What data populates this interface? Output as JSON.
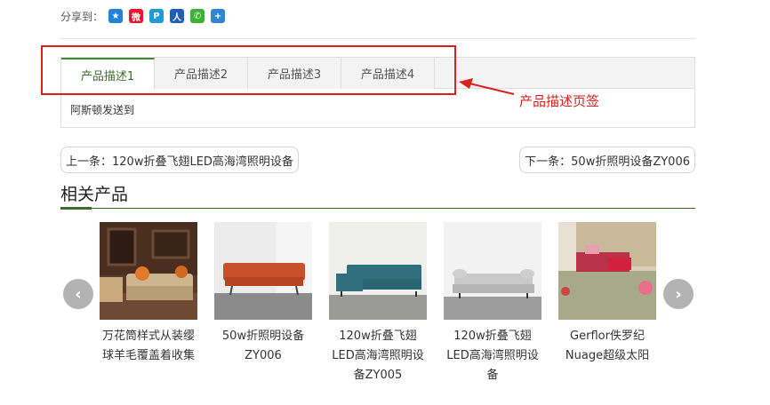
{
  "share": {
    "label": "分享到：",
    "icons": [
      {
        "name": "qzone-icon",
        "glyph": "★",
        "color": "#1f83d8"
      },
      {
        "name": "weibo-icon",
        "glyph": "微",
        "color": "#e6162d"
      },
      {
        "name": "tencent-weibo-icon",
        "glyph": "P",
        "color": "#1f9ad8"
      },
      {
        "name": "renren-icon",
        "glyph": "人",
        "color": "#1f5fb7"
      },
      {
        "name": "wechat-icon",
        "glyph": "✆",
        "color": "#3bb234"
      },
      {
        "name": "more-share-icon",
        "glyph": "+",
        "color": "#2f86d4"
      }
    ]
  },
  "tabs": {
    "items": [
      "产品描述1",
      "产品描述2",
      "产品描述3",
      "产品描述4"
    ],
    "active_index": 0,
    "content": "阿斯顿发送到"
  },
  "annotation": {
    "label": "产品描述页签",
    "color": "#d9211f"
  },
  "pager": {
    "prev": "上一条：120w折叠飞翅LED高海湾照明设备",
    "next": "下一条：50w折照明设备ZY006"
  },
  "related": {
    "title": "相关产品",
    "accent": "#3d6d2e",
    "products": [
      {
        "name": "万花筒样式从装缨球羊毛覆盖着收集",
        "thumb": "sofa-brown-room"
      },
      {
        "name": "50w折照明设备ZY006",
        "thumb": "sofa-orange"
      },
      {
        "name": "120w折叠飞翅LED高海湾照明设备ZY005",
        "thumb": "sofa-teal-sectional"
      },
      {
        "name": "120w折叠飞翅LED高海湾照明设备",
        "thumb": "sofa-grey"
      },
      {
        "name": "Gerflor佚罗纪Nuage超级太阳",
        "thumb": "bedroom-pink"
      }
    ],
    "prev_arrow": "‹",
    "next_arrow": "›"
  }
}
